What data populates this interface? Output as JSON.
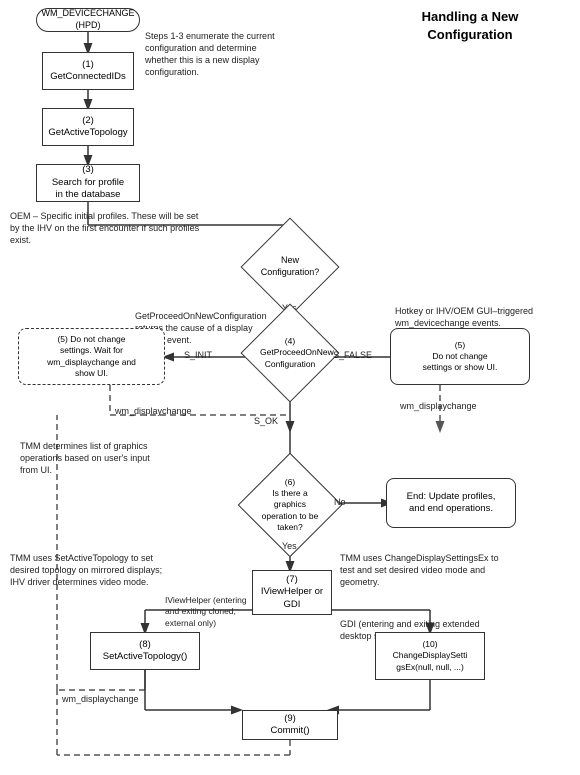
{
  "title": "Handling a New Configuration",
  "nodes": {
    "wm_devicechange": "WM_DEVICECHANGE (HPD)",
    "box1": "(1)\nGetConnectedIDs",
    "box2": "(2)\nGetActiveTopology",
    "box3": "(3)\nSearch for profile\nin the database",
    "diamond_new_config": "New\nConfiguration?",
    "get_proceed": "GetProceedOnNewConfiguration",
    "diamond_get_proceed": "(4)\nGetProceedOnNew\nConfiguration",
    "box5_left": "(5) Do not change\nsettings. Wait for\nwm_displaychange and\nshow UI.",
    "box5_right": "(5)\nDo not change\nsettings or show UI.",
    "diamond_graphics": "(6)\nIs there a\ngraphics\noperation to be\ntaken?",
    "box7": "(7)\nIViewHelper or\nGDI",
    "box8": "(8)\nSetActiveTopology()",
    "box9": "(9)\nCommit()",
    "box10": "(10)\nChangeDisplaySetti\ngsEx(null, null, ...)",
    "box11": "End:  Update profiles,\nand end operations.",
    "labels": {
      "yes1": "Yes",
      "yes2": "Yes",
      "no": "No",
      "s_ok": "S_OK",
      "s_init": "S_INIT",
      "s_false": "S_FALSE",
      "wm_displaychange1": "wm_displaychange",
      "wm_displaychange2": "wm_displaychange",
      "wm_displaychange3": "wm_displaychange"
    }
  },
  "annotations": {
    "steps1_3": "Steps 1-3 enumerate the\ncurrent configuration and\ndetermine whether this is a\nnew display configuration.",
    "oem": "OEM – Specific initial profiles. These\nwill be set by the IHV on the first\nencounter if such profiles exist.",
    "get_proceed_desc": "GetProceedOnNewConfiguration\nreturns the cause of a display\nchange event.",
    "hotkey": "Hotkey or IHV/OEM\nGUI–triggered\nwm_devicechange\nevents.",
    "tmm_list": "TMM determines list of\ngraphics operations based\non user's input from UI.",
    "tmm_set": "TMM uses SetActiveTopology to\nset desired topology on mirrored\ndisplays; IHV driver determines\nvideo mode.",
    "iviewhelper": "IViewHelper\n(entering and exiting\ncloned, external only)",
    "tmm_change": "TMM uses ChangeDisplaySettingsEx\nto test and set desired video mode\nand geometry.",
    "gdi": "GDI (entering and exiting\nextended desktop single view)"
  }
}
